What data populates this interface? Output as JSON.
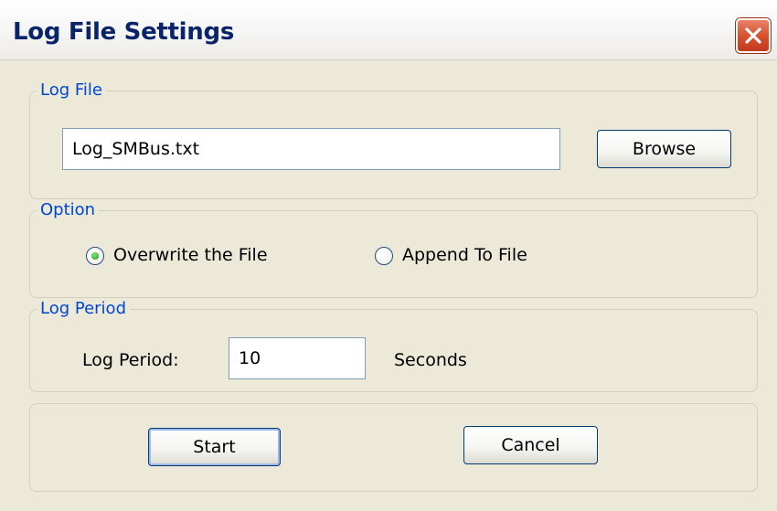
{
  "window": {
    "title": "Log File Settings"
  },
  "log_file_group": {
    "legend": "Log File",
    "path_value": "Log_SMBus.txt",
    "browse_label": "Browse"
  },
  "option_group": {
    "legend": "Option",
    "overwrite_label": "Overwrite the File",
    "append_label": "Append To File",
    "selected": "overwrite"
  },
  "log_period_group": {
    "legend": "Log Period",
    "period_label": "Log Period:",
    "period_value": "10",
    "unit_label": "Seconds"
  },
  "actions": {
    "start_label": "Start",
    "cancel_label": "Cancel"
  },
  "colors": {
    "title_text": "#0a246a",
    "legend_text": "#0046d5",
    "window_face": "#ece9d8",
    "close_button": "#d9512f",
    "radio_selected": "#21a121"
  }
}
